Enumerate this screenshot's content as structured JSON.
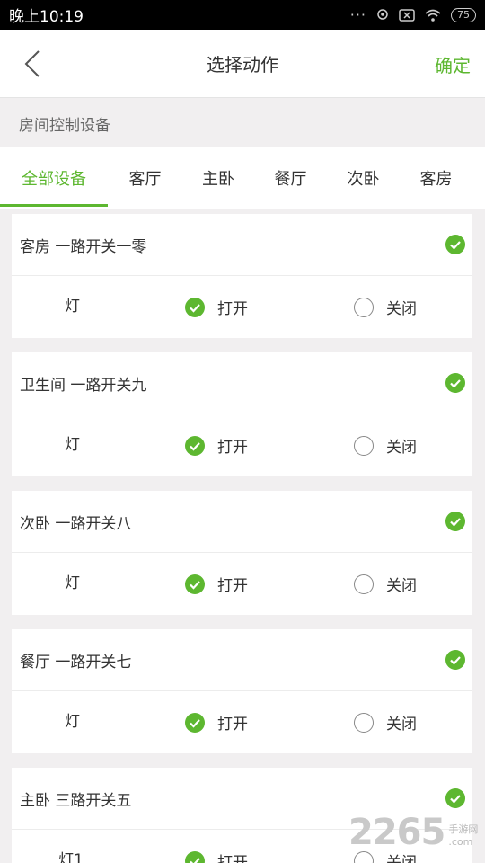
{
  "status_bar": {
    "time": "晚上10:19",
    "battery": "75"
  },
  "nav": {
    "title": "选择动作",
    "confirm": "确定"
  },
  "section_header": "房间控制设备",
  "tabs": [
    {
      "label": "全部设备",
      "active": true
    },
    {
      "label": "客厅",
      "active": false
    },
    {
      "label": "主卧",
      "active": false
    },
    {
      "label": "餐厅",
      "active": false
    },
    {
      "label": "次卧",
      "active": false
    },
    {
      "label": "客房",
      "active": false
    }
  ],
  "devices": [
    {
      "title": "客房 一路开关一零",
      "row_label": "灯",
      "on_label": "打开",
      "off_label": "关闭"
    },
    {
      "title": "卫生间 一路开关九",
      "row_label": "灯",
      "on_label": "打开",
      "off_label": "关闭"
    },
    {
      "title": "次卧 一路开关八",
      "row_label": "灯",
      "on_label": "打开",
      "off_label": "关闭"
    },
    {
      "title": "餐厅 一路开关七",
      "row_label": "灯",
      "on_label": "打开",
      "off_label": "关闭"
    },
    {
      "title": "主卧 三路开关五",
      "row_label": "灯1",
      "on_label": "打开",
      "off_label": "关闭"
    }
  ],
  "watermark": {
    "number": "2265",
    "suffix": ".com",
    "site": "手游网"
  },
  "colors": {
    "accent": "#5db730",
    "background": "#f1eff0"
  }
}
